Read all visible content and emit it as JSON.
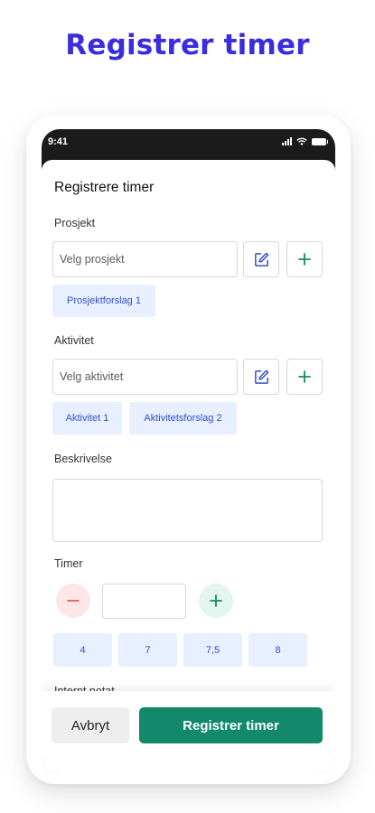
{
  "headline": "Registrer timer",
  "status_bar": {
    "time": "9:41"
  },
  "form": {
    "title": "Registrere timer",
    "project": {
      "label": "Prosjekt",
      "placeholder": "Velg prosjekt",
      "suggestions": [
        "Prosjektforslag 1"
      ]
    },
    "activity": {
      "label": "Aktivitet",
      "placeholder": "Velg aktivitet",
      "suggestions": [
        "Aktivitet 1",
        "Aktivitetsforslag 2"
      ]
    },
    "description": {
      "label": "Beskrivelse",
      "value": ""
    },
    "hours": {
      "label": "Timer",
      "value": "",
      "quick_values": [
        "4",
        "7",
        "7,5",
        "8"
      ]
    },
    "internal_note": {
      "label": "Internt notat"
    }
  },
  "actions": {
    "cancel_label": "Avbryt",
    "submit_label": "Registrer timer"
  },
  "colors": {
    "headline": "#3a2de0",
    "accent_blue": "#3450c8",
    "chip_bg": "#e8efff",
    "primary_green": "#11896a",
    "minus_bg": "#fde6e6",
    "minus_fg": "#e35d5d",
    "plus_bg": "#e2f5ee"
  },
  "icons": [
    "edit-icon",
    "plus-icon",
    "minus-icon",
    "signal-icon",
    "wifi-icon",
    "battery-icon"
  ]
}
